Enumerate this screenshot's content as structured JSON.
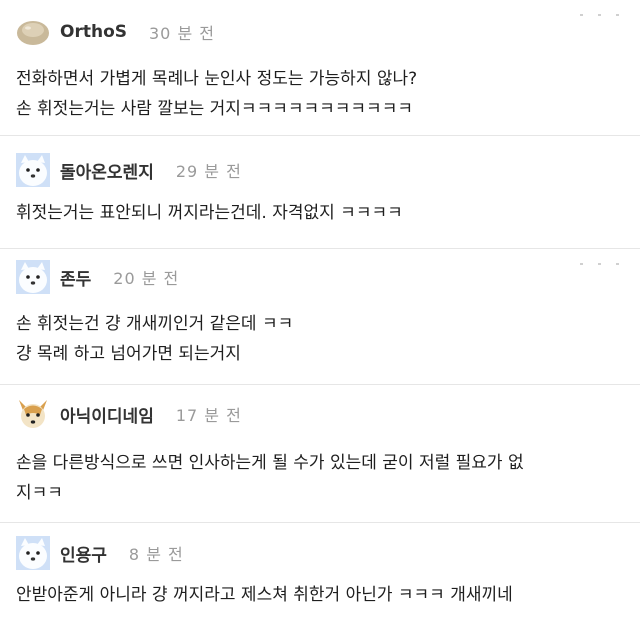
{
  "comments": [
    {
      "author": "OrthoS",
      "time": "30 분 전",
      "avatar_icon": "blob-avatar-icon",
      "lines": [
        "전화하면서 가볍게 목례나 눈인사 정도는 가능하지 않나?",
        "손 휘젓는거는 사람 깔보는 거지ㅋㅋㅋㅋㅋㅋㅋㅋㅋㅋㅋ"
      ]
    },
    {
      "author": "돌아온오렌지",
      "time": "29 분 전",
      "avatar_icon": "white-dog-avatar-icon",
      "lines": [
        "휘젓는거는 표안되니 꺼지라는건데. 자격없지 ㅋㅋㅋㅋ"
      ]
    },
    {
      "author": "존두",
      "time": "20 분 전",
      "avatar_icon": "white-dog-avatar-icon",
      "lines": [
        "손 휘젓는건 걍 개새끼인거 같은데 ㅋㅋ",
        "걍 목례 하고 넘어가면 되는거지"
      ]
    },
    {
      "author": "아닉이디네임",
      "time": "17 분 전",
      "avatar_icon": "fox-dog-avatar-icon",
      "lines": [
        "손을 다른방식으로 쓰면 인사하는게 될 수가 있는데 굳이 저럴 필요가 없",
        "지ㅋㅋ"
      ]
    },
    {
      "author": "인용구",
      "time": "8 분 전",
      "avatar_icon": "white-dog-avatar-icon",
      "lines": [
        "안받아준게 아니라 걍 꺼지라고 제스쳐 취한거 아닌가 ㅋㅋㅋ 개새끼네"
      ]
    }
  ],
  "colors": {
    "nickname": "#333333",
    "timestamp": "#9a9a9a",
    "divider": "#e6e6e6"
  }
}
